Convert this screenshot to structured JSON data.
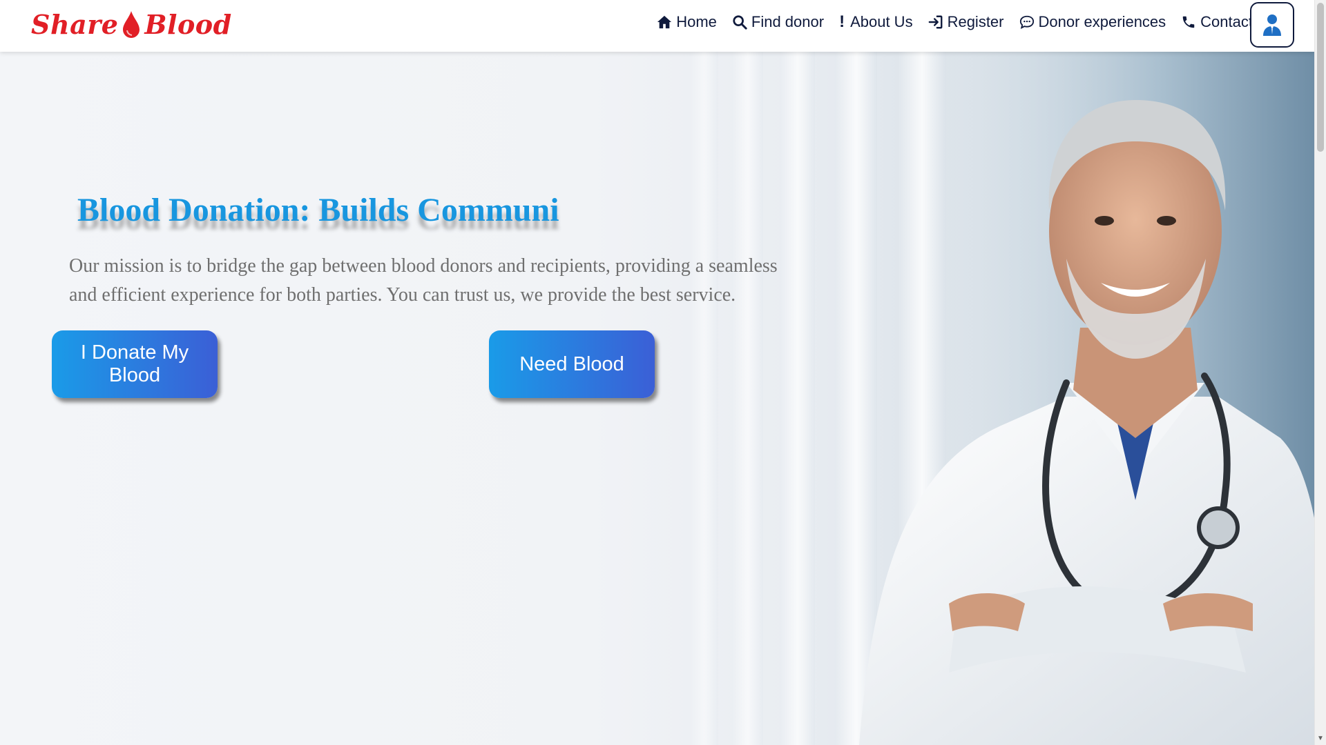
{
  "brand": {
    "part1": "Share",
    "part2": "Blood",
    "color": "#e11f26"
  },
  "nav": {
    "items": [
      {
        "label": "Home",
        "icon": "home-icon"
      },
      {
        "label": "Find donor",
        "icon": "search-icon"
      },
      {
        "label": "About Us",
        "icon": "exclamation-icon",
        "prefix": "!"
      },
      {
        "label": "Register",
        "icon": "sign-in-icon"
      },
      {
        "label": "Donor experiences",
        "icon": "chat-bubble-icon"
      },
      {
        "label": "Contact",
        "icon": "phone-icon"
      }
    ],
    "user_icon": "user-icon"
  },
  "hero": {
    "headline": "Blood Donation: Builds Communi",
    "mission": "Our mission is to bridge the gap between blood donors and recipients, providing a seamless and efficient experience for both parties. You can trust us, we provide the best service.",
    "donate_button": "I Donate My Blood",
    "need_button": "Need Blood",
    "accent_color": "#1896df",
    "button_gradient_start": "#1a9be8",
    "button_gradient_end": "#3b5fd6"
  }
}
